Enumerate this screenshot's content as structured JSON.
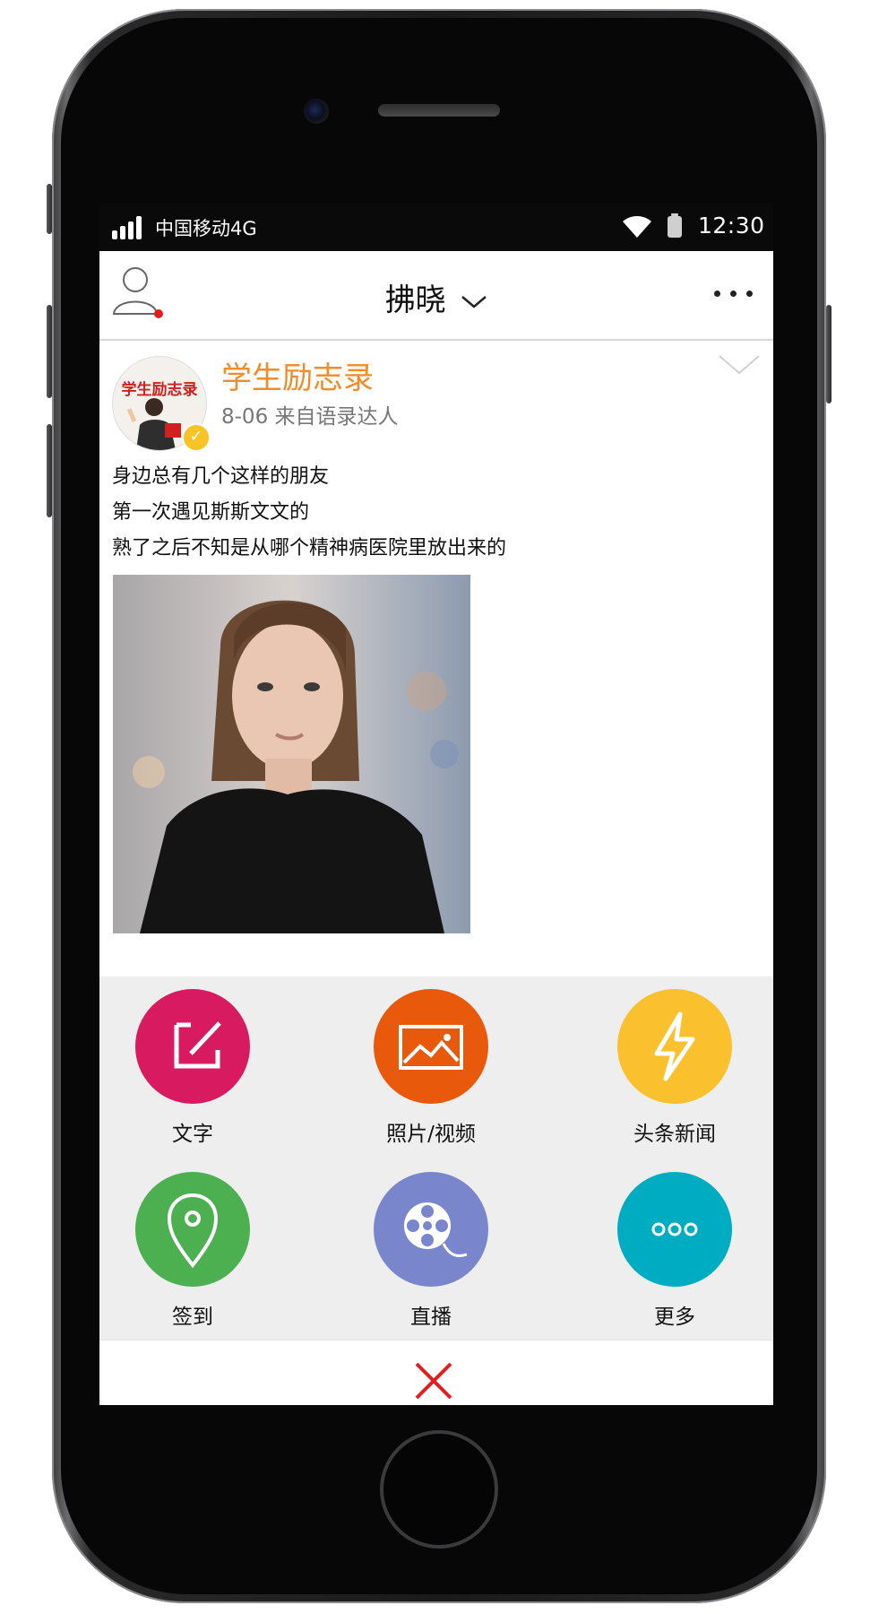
{
  "statusbar": {
    "carrier": "中国移动4G",
    "time": "12:30"
  },
  "navbar": {
    "title": "拂晓",
    "icons": [
      "profile-icon",
      "chevron-down-icon",
      "more-icon"
    ]
  },
  "post": {
    "author": "学生励志录",
    "avatar_text": "学生励志录",
    "meta": "8-06 来自语录达人",
    "lines": [
      "身边总有几个这样的朋友",
      "第一次遇见斯斯文文的",
      "熟了之后不知是从哪个精神病医院里放出来的"
    ],
    "verified": true
  },
  "actions": [
    {
      "label": "文字",
      "icon": "edit-icon",
      "color": "#d81b60"
    },
    {
      "label": "照片/视频",
      "icon": "image-icon",
      "color": "#e8590c"
    },
    {
      "label": "头条新闻",
      "icon": "lightning-icon",
      "color": "#fbc02d"
    },
    {
      "label": "签到",
      "icon": "location-icon",
      "color": "#4caf50"
    },
    {
      "label": "直播",
      "icon": "film-reel-icon",
      "color": "#7986cb"
    },
    {
      "label": "更多",
      "icon": "more-icon",
      "color": "#00acc1"
    }
  ],
  "close": {
    "icon": "close-icon",
    "color": "#e02020"
  }
}
